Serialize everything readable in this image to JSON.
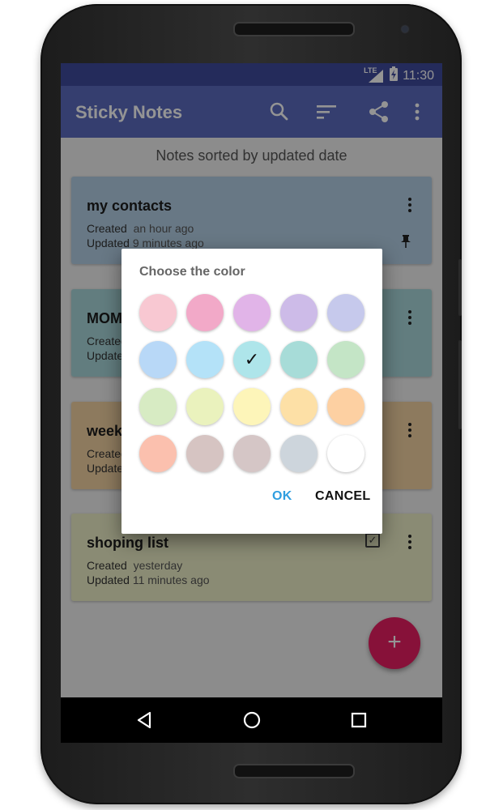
{
  "status_bar": {
    "network": "LTE",
    "time": "11:30"
  },
  "app_bar": {
    "title": "Sticky Notes",
    "icons": [
      "search-icon",
      "sort-icon",
      "share-icon",
      "more-vert-icon"
    ]
  },
  "list": {
    "sort_caption": "Notes sorted by updated date",
    "notes": [
      {
        "title": "my contacts",
        "created_label": "Created",
        "created": "an hour ago",
        "updated_label": "Updated",
        "updated": "9 minutes ago",
        "color": "#b3cfe6",
        "pinned": true,
        "checked": false
      },
      {
        "title": "MOM",
        "created_label": "Created",
        "created": "",
        "updated_label": "Updated",
        "updated": "",
        "color": "#a9d8db",
        "pinned": false,
        "checked": false
      },
      {
        "title": "week",
        "created_label": "Created",
        "created": "",
        "updated_label": "Updated",
        "updated": "",
        "color": "#f3d3a3",
        "pinned": false,
        "checked": false
      },
      {
        "title": "shoping list",
        "created_label": "Created",
        "created": "yesterday",
        "updated_label": "Updated",
        "updated": "11 minutes ago",
        "color": "#eeefc8",
        "pinned": false,
        "checked": true
      }
    ],
    "fab_label": "+"
  },
  "dialog": {
    "title": "Choose the color",
    "selected_index": 7,
    "check_mark": "✓",
    "swatches": [
      "#f8c8d2",
      "#f2a9c8",
      "#e1b4e8",
      "#cdbbe8",
      "#c6c9ec",
      "#b8d8f7",
      "#b4e2f8",
      "#aee5ea",
      "#a7dcd8",
      "#c4e5c6",
      "#d7ebc3",
      "#eaf2bd",
      "#fdf5b9",
      "#fde0a6",
      "#fdd0a2",
      "#fbc0ae",
      "#d6c4c2",
      "#d5c6c6",
      "#cdd5dc",
      "#ffffff"
    ],
    "ok_label": "OK",
    "cancel_label": "CANCEL",
    "ok_color": "#2f9ee0"
  },
  "nav_bar": {
    "icons": [
      "back-icon",
      "home-icon",
      "recents-icon"
    ]
  }
}
